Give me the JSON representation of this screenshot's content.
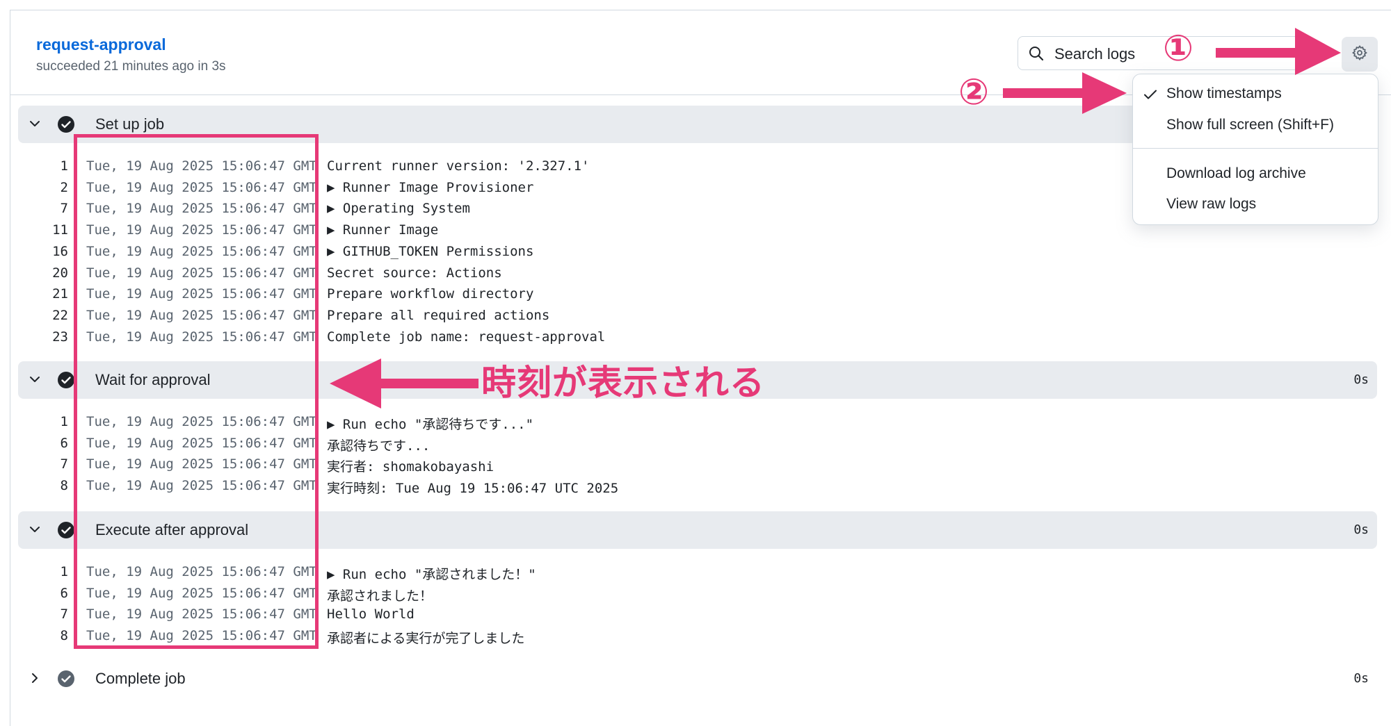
{
  "job": {
    "title": "request-approval",
    "subtitle": "succeeded 21 minutes ago in 3s"
  },
  "search": {
    "placeholder": "Search logs"
  },
  "menu": {
    "items": [
      {
        "label": "Show timestamps",
        "checked": true
      },
      {
        "label": "Show full screen (Shift+F)"
      },
      {
        "label": "Download log archive"
      },
      {
        "label": "View raw logs"
      }
    ]
  },
  "steps": [
    {
      "name": "Set up job",
      "duration": "",
      "expanded": true,
      "lines": [
        {
          "num": "1",
          "ts": "Tue, 19 Aug 2025 15:06:47 GMT",
          "msg": "Current runner version: '2.327.1'"
        },
        {
          "num": "2",
          "ts": "Tue, 19 Aug 2025 15:06:47 GMT",
          "msg": "▶ Runner Image Provisioner"
        },
        {
          "num": "7",
          "ts": "Tue, 19 Aug 2025 15:06:47 GMT",
          "msg": "▶ Operating System"
        },
        {
          "num": "11",
          "ts": "Tue, 19 Aug 2025 15:06:47 GMT",
          "msg": "▶ Runner Image"
        },
        {
          "num": "16",
          "ts": "Tue, 19 Aug 2025 15:06:47 GMT",
          "msg": "▶ GITHUB_TOKEN Permissions"
        },
        {
          "num": "20",
          "ts": "Tue, 19 Aug 2025 15:06:47 GMT",
          "msg": "Secret source: Actions"
        },
        {
          "num": "21",
          "ts": "Tue, 19 Aug 2025 15:06:47 GMT",
          "msg": "Prepare workflow directory"
        },
        {
          "num": "22",
          "ts": "Tue, 19 Aug 2025 15:06:47 GMT",
          "msg": "Prepare all required actions"
        },
        {
          "num": "23",
          "ts": "Tue, 19 Aug 2025 15:06:47 GMT",
          "msg": "Complete job name: request-approval"
        }
      ]
    },
    {
      "name": "Wait for approval",
      "duration": "0s",
      "expanded": true,
      "lines": [
        {
          "num": "1",
          "ts": "Tue, 19 Aug 2025 15:06:47 GMT",
          "msg": "▶ Run echo \"承認待ちです...\""
        },
        {
          "num": "6",
          "ts": "Tue, 19 Aug 2025 15:06:47 GMT",
          "msg": "承認待ちです..."
        },
        {
          "num": "7",
          "ts": "Tue, 19 Aug 2025 15:06:47 GMT",
          "msg": "実行者: shomakobayashi"
        },
        {
          "num": "8",
          "ts": "Tue, 19 Aug 2025 15:06:47 GMT",
          "msg": "実行時刻: Tue Aug 19 15:06:47 UTC 2025"
        }
      ]
    },
    {
      "name": "Execute after approval",
      "duration": "0s",
      "expanded": true,
      "lines": [
        {
          "num": "1",
          "ts": "Tue, 19 Aug 2025 15:06:47 GMT",
          "msg": "▶ Run echo \"承認されました！\""
        },
        {
          "num": "6",
          "ts": "Tue, 19 Aug 2025 15:06:47 GMT",
          "msg": "承認されました！"
        },
        {
          "num": "7",
          "ts": "Tue, 19 Aug 2025 15:06:47 GMT",
          "msg": "Hello World"
        },
        {
          "num": "8",
          "ts": "Tue, 19 Aug 2025 15:06:47 GMT",
          "msg": "承認者による実行が完了しました"
        }
      ]
    },
    {
      "name": "Complete job",
      "duration": "0s",
      "expanded": false,
      "lines": []
    }
  ],
  "annotations": {
    "label": "時刻が表示される",
    "marker_1": "①",
    "marker_2": "②",
    "color": "#e63977"
  }
}
